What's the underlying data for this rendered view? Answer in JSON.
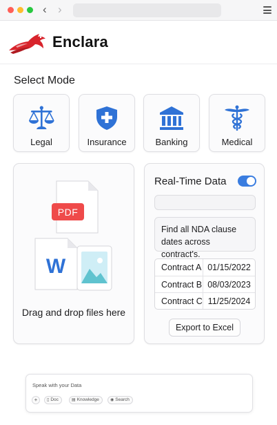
{
  "browser": {
    "back_glyph": "‹",
    "forward_glyph": "›"
  },
  "brand": {
    "name": "Enclara",
    "logo_icon": "horse-head-icon",
    "logo_color": "#d8242c"
  },
  "mode_section": {
    "title": "Select Mode",
    "modes": [
      {
        "label": "Legal",
        "icon": "scales-icon"
      },
      {
        "label": "Insurance",
        "icon": "shield-plus-icon"
      },
      {
        "label": "Banking",
        "icon": "bank-icon"
      },
      {
        "label": "Medical",
        "icon": "caduceus-icon"
      }
    ],
    "icon_color": "#2f72d6"
  },
  "upload": {
    "pdf_label": "PDF",
    "word_label": "W",
    "instruction": "Drag and drop files here"
  },
  "realtime": {
    "title": "Real-Time Data",
    "toggle_on": true,
    "query": "Find all NDA clause dates across contract's.",
    "rows": [
      {
        "contract": "Contract A",
        "date": "01/15/2022"
      },
      {
        "contract": "Contract B",
        "date": "08/03/2023"
      },
      {
        "contract": "Contract C",
        "date": "11/25/2024"
      }
    ],
    "export_label": "Export to Excel",
    "accent_color": "#3a7de0"
  },
  "chat": {
    "placeholder": "Speak with your Data",
    "add_label": "+",
    "chips": [
      {
        "label": "Doc",
        "icon": "document-icon"
      },
      {
        "label": "Knowledge",
        "icon": "book-icon"
      },
      {
        "label": "Search",
        "icon": "globe-icon"
      }
    ]
  }
}
